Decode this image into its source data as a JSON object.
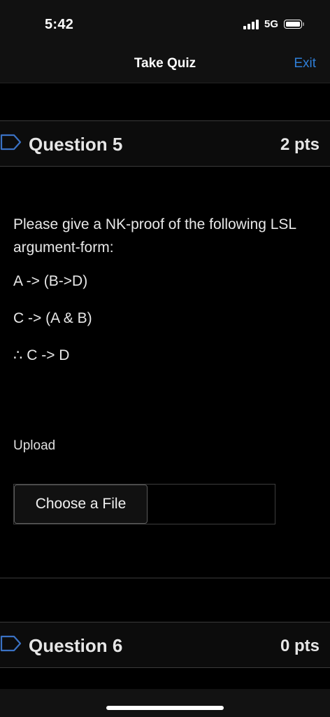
{
  "status_bar": {
    "time": "5:42",
    "network": "5G",
    "signal_icon": "signal-bars-icon",
    "battery_icon": "battery-icon"
  },
  "nav": {
    "title": "Take Quiz",
    "exit_label": "Exit",
    "accent_color": "#2f7fd8"
  },
  "questions": [
    {
      "title": "Question 5",
      "points": "2 pts",
      "flag_icon": "bookmark-flag-icon",
      "prompt": "Please give a NK-proof of the following LSL argument-form:",
      "premises": [
        "A -> (B->D)",
        "C -> (A & B)"
      ],
      "conclusion": "∴ C -> D",
      "upload_label": "Upload",
      "file_button_label": "Choose a File"
    },
    {
      "title": "Question 6",
      "points": "0 pts",
      "flag_icon": "bookmark-flag-icon"
    }
  ]
}
